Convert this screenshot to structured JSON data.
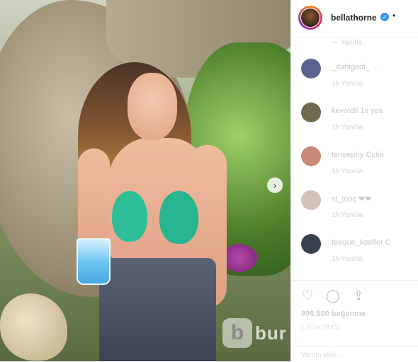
{
  "post": {
    "username": "bellathorne",
    "more": "•",
    "verified": "✓"
  },
  "photo": {
    "next_arrow": "›",
    "watermark_text": "bur",
    "watermark_logo": "b"
  },
  "comments": {
    "first_meta": "— Yanıtla",
    "items": [
      {
        "name": "_danigedi_ ...",
        "meta": "1h   Yanıtla",
        "color": "#5a6390"
      },
      {
        "name": "kevoldtl 1s yos",
        "meta": "1h   Yanıtla",
        "color": "#6e6a4e"
      },
      {
        "name": "teneephy Cutie",
        "meta": "1h   Yanıtla",
        "color": "#c98a78"
      },
      {
        "name": "st_iuoc  ❤❤",
        "meta": "1h   Yanıtla",
        "color": "#d6c2b8"
      },
      {
        "name": "teeque_koefler C",
        "meta": "1h   Yanıtla",
        "color": "#3b4050"
      }
    ]
  },
  "actions": {
    "like_icon": "♡",
    "comment_icon": "◯",
    "share_icon": "⇪",
    "likes": "996.500 beğenme",
    "date": "1 GÜN ÖNCE"
  },
  "comment_box": {
    "placeholder": "Yorum ekle..."
  }
}
